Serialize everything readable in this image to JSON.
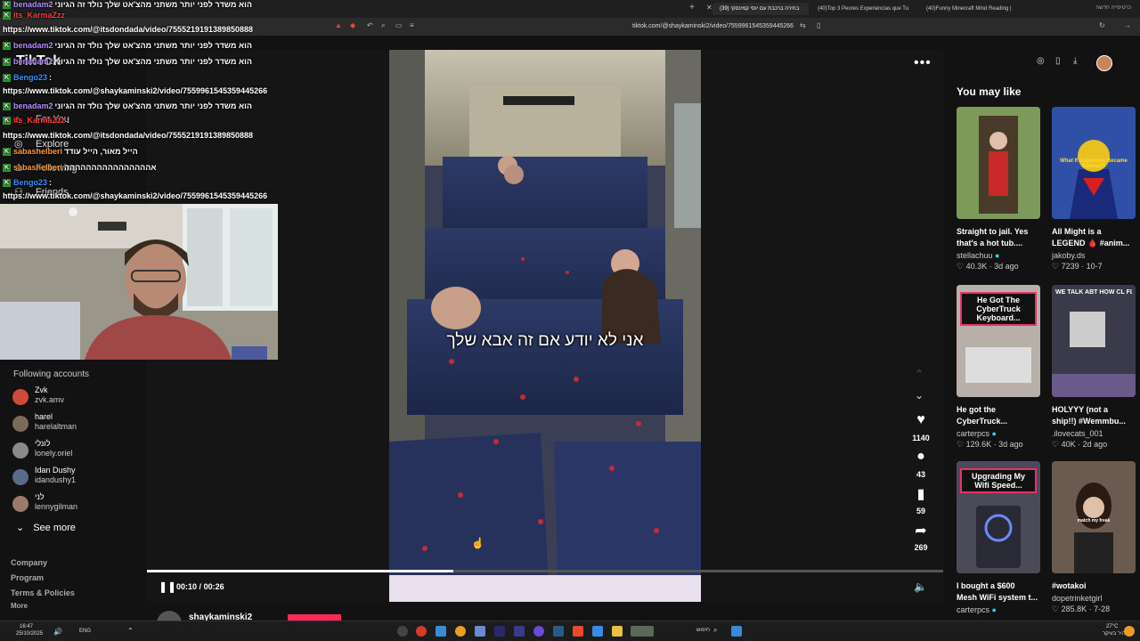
{
  "browser": {
    "tabs": [
      {
        "label": "(39) בחירה ברכבת עם יוסי קמינסקי",
        "active": true
      },
      {
        "label": "(40)Top 3 Peores Experiencias que Tu",
        "active": false
      },
      {
        "label": "(40)Funny Minecraft Mind Reading |",
        "active": false
      },
      {
        "label": "כרטיסייה חדשה",
        "active": false
      }
    ],
    "url": "tiktok.com/@shaykaminski2/video/7559961545359445266",
    "new_tab_symbol": "+",
    "close_symbol": "✕"
  },
  "sidebar": {
    "logo": "TikTok",
    "nav": [
      {
        "label": "For You",
        "icon": "home-icon"
      },
      {
        "label": "Explore",
        "icon": "compass-icon"
      },
      {
        "label": "Following",
        "icon": "user-plus-icon"
      },
      {
        "label": "Friends",
        "icon": "friends-icon"
      }
    ],
    "following_title": "Following accounts",
    "accounts": [
      {
        "name": "Zvk",
        "handle": "zvk.amv",
        "color": "#d04a3a"
      },
      {
        "name": "harel",
        "handle": "harelaltman",
        "color": "#7a6a5a"
      },
      {
        "name": "לונלי",
        "handle": "lonely.oriel",
        "color": "#8a8a8a"
      },
      {
        "name": "Idan Dushy",
        "handle": "idandushy1",
        "color": "#5a6a8a"
      },
      {
        "name": "לני",
        "handle": "lennygilman",
        "color": "#9a7a6a"
      }
    ],
    "see_more": "See more",
    "footer": [
      "Company",
      "Program",
      "Terms & Policies",
      "More"
    ]
  },
  "chat": [
    {
      "user": "benadam2",
      "color": "#b38cff",
      "msg": "הוא משדר לפני יותר משתני מהצ'אט שלך נולד זה הגיוני"
    },
    {
      "user": "its_KarmaZzz",
      "color": "#ff3a3a",
      "msg": ""
    },
    {
      "user": "",
      "color": "#fff",
      "msg": "https://www.tiktok.com/@itsdondada/video/7555219191389850888"
    },
    {
      "user": "benadam2",
      "color": "#b38cff",
      "msg": "הוא משדר לפני יותר משתני מהצ'אט שלך נולד זה הגיוני"
    },
    {
      "user": "benadam2",
      "color": "#b38cff",
      "msg": "הוא משדר לפני יותר משתני מהצ'אט שלך נולד זה הגיוני"
    },
    {
      "user": "Bengo23",
      "color": "#3a8fff",
      "msg": ":"
    },
    {
      "user": "",
      "color": "#fff",
      "msg": "https://www.tiktok.com/@shaykaminski2/video/7559961545359445266"
    },
    {
      "user": "benadam2",
      "color": "#b38cff",
      "msg": "הוא משדר לפני יותר משתני מהצ'אט שלך נולד זה הגיוני"
    },
    {
      "user": "its_KarmaZzz",
      "color": "#ff3a3a",
      "msg": ":"
    },
    {
      "user": "",
      "color": "#fff",
      "msg": "https://www.tiktok.com/@itsdondada/video/7555219191389850888"
    },
    {
      "user": "sabashelberi",
      "color": "#ff9a3a",
      "msg": "הייל מאור, הייל עודד"
    },
    {
      "user": "sabashelberi",
      "color": "#ff9a3a",
      "msg": "אהההההההההההההההה"
    },
    {
      "user": "Bengo23",
      "color": "#3a8fff",
      "msg": ":"
    },
    {
      "user": "",
      "color": "#fff",
      "msg": "https://www.tiktok.com/@shaykaminski2/video/7559961545359445266"
    }
  ],
  "video": {
    "subtitle": "אני לא יודע אם זה אבא שלך",
    "time_current": "00:10",
    "time_total": "00:26",
    "time_separator": "/",
    "progress": 0.385,
    "author": "shaykaminski2"
  },
  "actions": [
    {
      "icon": "heart-icon",
      "glyph": "♥",
      "count": "1140"
    },
    {
      "icon": "comment-icon",
      "glyph": "●",
      "count": "43"
    },
    {
      "icon": "bookmark-icon",
      "glyph": "▮",
      "count": "59"
    },
    {
      "icon": "share-icon",
      "glyph": "➦",
      "count": "269"
    }
  ],
  "right": {
    "title": "You may like",
    "cards": [
      {
        "title": "Straight to jail. Yes\nthat's a hot tub....",
        "author": "stellachuu",
        "verified": true,
        "likes": "40.3K",
        "date": "3d ago",
        "thumb_text": "",
        "bg": "#6b5a4a"
      },
      {
        "title": "All Might is a\nLEGEND 🩸 #anim...",
        "author": "jakoby.ds",
        "verified": false,
        "likes": "7239",
        "date": "10-7",
        "thumb_text": "What If Superman Became Batman?",
        "bg": "#2a4a9a"
      },
      {
        "title": "He got the\nCyberTruck...",
        "author": "carterpcs",
        "verified": true,
        "likes": "129.6K",
        "date": "3d ago",
        "thumb_text": "He Got The CyberTruck Keyboard...",
        "bg": "#c8c0b8"
      },
      {
        "title": "HOLYYY (not a\nship!!) #Wemmbu...",
        "author": ".ilovecats_001",
        "verified": false,
        "likes": "40K",
        "date": "2d ago",
        "thumb_text": "WE TALK ABT HOW CL FLAME WAS!?😭",
        "bg": "#3a3a4a"
      },
      {
        "title": "I bought a $600\nMesh WiFi system t...",
        "author": "carterpcs",
        "verified": true,
        "likes": "",
        "date": "",
        "thumb_text": "Upgrading My Wifi Speed...",
        "bg": "#4a4a5a"
      },
      {
        "title": "#wotakoi",
        "author": "dopetrinketgirl",
        "verified": false,
        "likes": "285.8K",
        "date": "7-28",
        "thumb_text": "match my freak",
        "bg": "#5a4a42"
      }
    ]
  },
  "taskbar": {
    "time": "16:47",
    "date": "25/10/2025",
    "lang": "ENG",
    "weather": "27°C",
    "weather_desc": "בהיר בעיקר",
    "search_placeholder": "חיפוש"
  },
  "colors": {
    "accent": "#fe2c55",
    "bg": "#121212"
  }
}
